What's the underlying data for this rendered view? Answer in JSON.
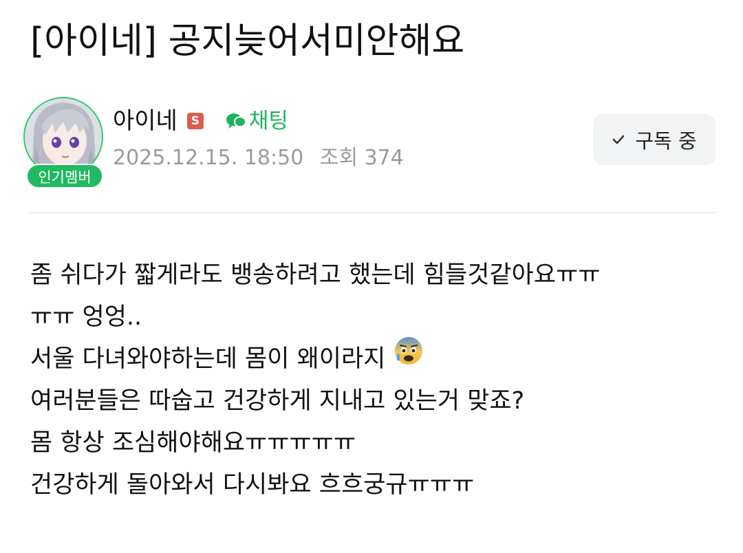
{
  "post": {
    "title": "[아이네] 공지늦어서미안해요"
  },
  "author": {
    "name": "아이네",
    "staff_badge": "S",
    "member_badge": "인기멤버",
    "chat_label": "채팅"
  },
  "meta": {
    "date": "2025.12.15. 18:50",
    "views": "조회 374"
  },
  "subscribe": {
    "label": "구독 중"
  },
  "content": {
    "lines": [
      "좀 쉬다가 짧게라도 뱅송하려고 했는데 힘들것같아요ㅠㅠ",
      "ㅠㅠ 엉엉..",
      "서울 다녀와야하는데 몸이 왜이라지",
      "여러분들은 따숩고 건강하게 지내고 있는거 맞죠?",
      "몸 항상 조심해야해요ㅠㅠㅠㅠㅠ",
      "건강하게 돌아와서 다시봐요 흐흐궁규ㅠㅠㅠ"
    ],
    "emoji": "anxious-face-with-sweat-icon"
  },
  "colors": {
    "accent_green": "#21b962",
    "staff_red": "#e05a4f",
    "meta_gray": "#9a9a9a",
    "button_bg": "#f2f3f5"
  }
}
